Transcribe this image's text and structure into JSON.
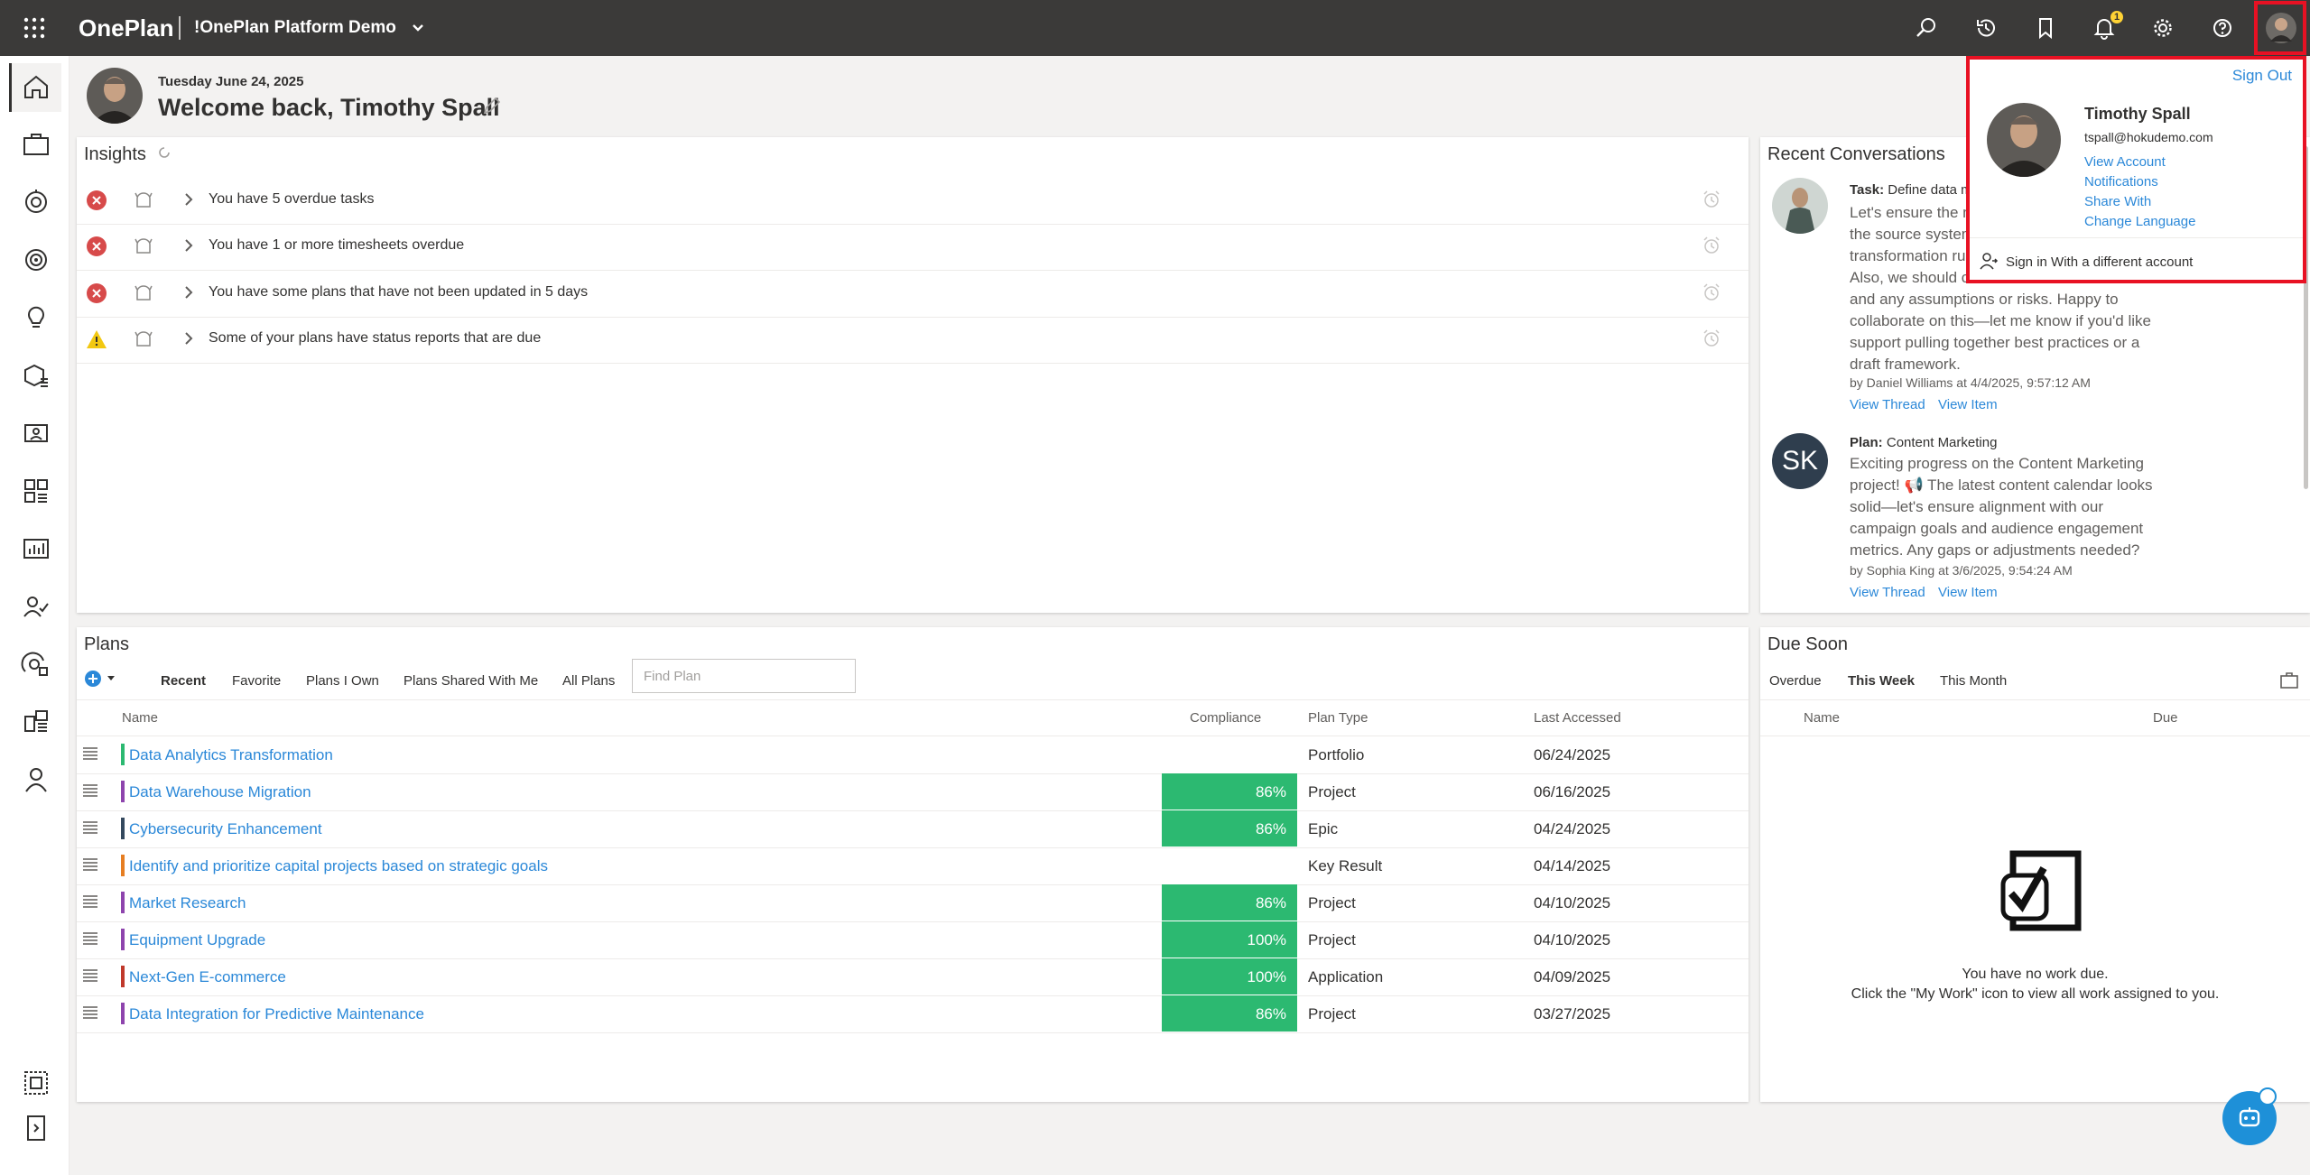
{
  "topbar": {
    "brand": "OnePlan",
    "workspace": "!OnePlan Platform Demo",
    "notification_count": "1",
    "icons": [
      "search-icon",
      "history-icon",
      "bookmark-icon",
      "bell-icon",
      "gear-icon",
      "help-icon",
      "avatar"
    ]
  },
  "rail": {
    "items": [
      "home-icon",
      "briefcase-icon",
      "timesheet-icon",
      "target-icon",
      "idea-icon",
      "resources-icon",
      "contacts-icon",
      "dashboard-icon",
      "reports-icon",
      "team-icon",
      "strategy-icon",
      "portfolio-icon",
      "person-icon"
    ],
    "bottom": [
      "layout-icon",
      "expand-icon"
    ]
  },
  "header": {
    "date": "Tuesday June 24, 2025",
    "welcome": "Welcome back, Timothy Spall"
  },
  "insights": {
    "title": "Insights",
    "rows": [
      {
        "status": "error",
        "text": "You have 5 overdue tasks"
      },
      {
        "status": "error",
        "text": "You have 1 or more timesheets overdue"
      },
      {
        "status": "error",
        "text": "You have some plans that have not been updated in 5 days"
      },
      {
        "status": "warning",
        "text": "Some of your plans have status reports that are due"
      }
    ]
  },
  "conversations": {
    "title": "Recent Conversations",
    "items": [
      {
        "type_label": "Task:",
        "item": "Define data m",
        "lines": [
          "Let's ensure the m",
          "the source system",
          "transformation ru",
          "Also, we should c",
          "and any assumptions or risks. Happy to",
          "collaborate on this—let me know if you'd like",
          "support pulling together best practices or a",
          "draft framework."
        ],
        "by": "by Daniel Williams at 4/4/2025, 9:57:12 AM",
        "view_thread": "View Thread",
        "view_item": "View Item"
      },
      {
        "initials": "SK",
        "type_label": "Plan:",
        "item": "Content Marketing",
        "lines": [
          "Exciting progress on the Content Marketing",
          "project! 📢 The latest content calendar looks",
          "solid—let's ensure alignment with our",
          "campaign goals and audience engagement",
          "metrics. Any gaps or adjustments needed?"
        ],
        "by": "by Sophia King at 3/6/2025, 9:54:24 AM",
        "view_thread": "View Thread",
        "view_item": "View Item"
      }
    ]
  },
  "plans": {
    "title": "Plans",
    "tabs": [
      "Recent",
      "Favorite",
      "Plans I Own",
      "Plans Shared With Me",
      "All Plans"
    ],
    "active_tab": "Recent",
    "search_placeholder": "Find Plan",
    "columns": [
      "Name",
      "Compliance",
      "Plan Type",
      "Last Accessed"
    ],
    "rows": [
      {
        "name": "Data Analytics Transformation",
        "color": "#2cb971",
        "compliance": "",
        "type": "Portfolio",
        "date": "06/24/2025"
      },
      {
        "name": "Data Warehouse Migration",
        "color": "#8e44ad",
        "compliance": "86%",
        "type": "Project",
        "date": "06/16/2025"
      },
      {
        "name": "Cybersecurity Enhancement",
        "color": "#34495e",
        "compliance": "86%",
        "type": "Epic",
        "date": "04/24/2025"
      },
      {
        "name": "Identify and prioritize capital projects based on strategic goals",
        "color": "#e67e22",
        "compliance": "",
        "type": "Key Result",
        "date": "04/14/2025"
      },
      {
        "name": "Market Research",
        "color": "#8e44ad",
        "compliance": "86%",
        "type": "Project",
        "date": "04/10/2025"
      },
      {
        "name": "Equipment Upgrade",
        "color": "#8e44ad",
        "compliance": "100%",
        "type": "Project",
        "date": "04/10/2025"
      },
      {
        "name": "Next-Gen E-commerce",
        "color": "#c0392b",
        "compliance": "100%",
        "type": "Application",
        "date": "04/09/2025"
      },
      {
        "name": "Data Integration for Predictive Maintenance",
        "color": "#8e44ad",
        "compliance": "86%",
        "type": "Project",
        "date": "03/27/2025"
      }
    ]
  },
  "due_soon": {
    "title": "Due Soon",
    "tabs": [
      "Overdue",
      "This Week",
      "This Month"
    ],
    "active_tab": "This Week",
    "columns": [
      "Name",
      "Due"
    ],
    "empty_line1": "You have no work due.",
    "empty_line2": "Click the \"My Work\" icon to view all work assigned to you."
  },
  "account_popup": {
    "sign_out": "Sign Out",
    "name": "Timothy Spall",
    "email": "tspall@hokudemo.com",
    "links": [
      "View Account",
      "Notifications",
      "Share With",
      "Change Language"
    ],
    "alt_account": "Sign in With a different account"
  }
}
